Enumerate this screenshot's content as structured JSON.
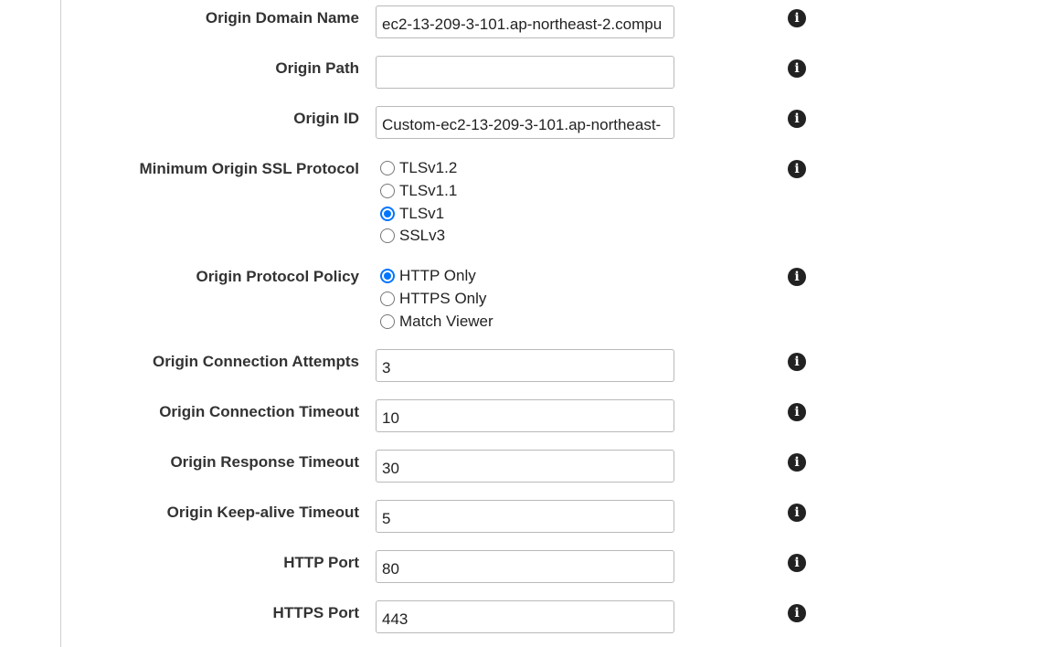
{
  "fields": [
    {
      "label": "Origin Domain Name",
      "value": "ec2-13-209-3-101.ap-northeast-2.compu"
    },
    {
      "label": "Origin Path",
      "value": ""
    },
    {
      "label": "Origin ID",
      "value": "Custom-ec2-13-209-3-101.ap-northeast-"
    }
  ],
  "ssl": {
    "label": "Minimum Origin SSL Protocol",
    "options": [
      "TLSv1.2",
      "TLSv1.1",
      "TLSv1",
      "SSLv3"
    ],
    "selected": "TLSv1"
  },
  "protocol_policy": {
    "label": "Origin Protocol Policy",
    "options": [
      "HTTP Only",
      "HTTPS Only",
      "Match Viewer"
    ],
    "selected": "HTTP Only"
  },
  "numeric_fields": [
    {
      "label": "Origin Connection Attempts",
      "value": "3"
    },
    {
      "label": "Origin Connection Timeout",
      "value": "10"
    },
    {
      "label": "Origin Response Timeout",
      "value": "30"
    },
    {
      "label": "Origin Keep-alive Timeout",
      "value": "5"
    },
    {
      "label": "HTTP Port",
      "value": "80"
    },
    {
      "label": "HTTPS Port",
      "value": "443"
    }
  ],
  "info_icon_glyph": "i"
}
